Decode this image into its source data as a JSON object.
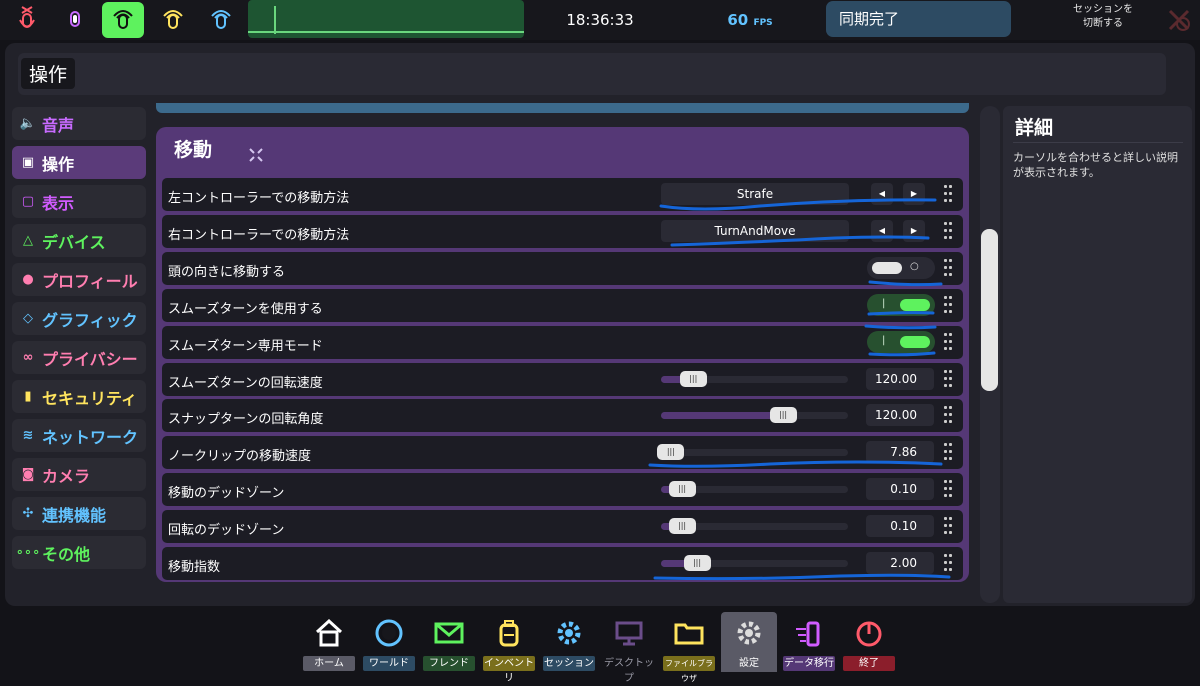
{
  "topbar": {
    "mic_buttons": [
      {
        "icon": "mic-muted-icon"
      },
      {
        "icon": "mic-off-icon"
      },
      {
        "icon": "mic-broadcast-icon",
        "active": true
      },
      {
        "icon": "mic-yellow-icon"
      },
      {
        "icon": "mic-blue-icon"
      }
    ],
    "time": "18:36:33",
    "fps_value": "60",
    "fps_unit": "FPS",
    "sync_status": "同期完了",
    "switch_session_line1": "セッションを",
    "switch_session_line2": "切断する"
  },
  "page_title": "操作",
  "nav": {
    "items": [
      {
        "label": "音声",
        "icon": "speaker-icon",
        "color": "#c86bff"
      },
      {
        "label": "操作",
        "icon": "gamepad-icon",
        "color": "#ffffff",
        "active": true
      },
      {
        "label": "表示",
        "icon": "display-icon",
        "color": "#d15cff"
      },
      {
        "label": "デバイス",
        "icon": "devices-icon",
        "color": "#5ef25e"
      },
      {
        "label": "プロフィール",
        "icon": "person-icon",
        "color": "#ff7eb0"
      },
      {
        "label": "グラフィック",
        "icon": "graphic-icon",
        "color": "#62c3ff"
      },
      {
        "label": "プライバシー",
        "icon": "privacy-icon",
        "color": "#ff7eb0"
      },
      {
        "label": "セキュリティ",
        "icon": "lock-icon",
        "color": "#ffe45e"
      },
      {
        "label": "ネットワーク",
        "icon": "wifi-icon",
        "color": "#62c3ff"
      },
      {
        "label": "カメラ",
        "icon": "camera-icon",
        "color": "#ff7eb0"
      },
      {
        "label": "連携機能",
        "icon": "integration-icon",
        "color": "#62c3ff"
      },
      {
        "label": "その他",
        "icon": "more-icon",
        "color": "#5ef25e"
      }
    ]
  },
  "section": {
    "title": "移動",
    "rows": [
      {
        "type": "select",
        "label": "左コントローラーでの移動方法",
        "value": "Strafe"
      },
      {
        "type": "select",
        "label": "右コントローラーでの移動方法",
        "value": "TurnAndMove"
      },
      {
        "type": "toggle",
        "label": "頭の向きに移動する",
        "on": false
      },
      {
        "type": "toggle",
        "label": "スムーズターンを使用する",
        "on": true
      },
      {
        "type": "toggle",
        "label": "スムーズターン専用モード",
        "on": true
      },
      {
        "type": "slider",
        "label": "スムーズターンの回転速度",
        "value": "120.00",
        "fraction": 0.17
      },
      {
        "type": "slider",
        "label": "スナップターンの回転角度",
        "value": "120.00",
        "fraction": 0.65
      },
      {
        "type": "slider",
        "label": "ノークリップの移動速度",
        "value": "7.86",
        "fraction": 0.05
      },
      {
        "type": "slider",
        "label": "移動のデッドゾーン",
        "value": "0.10",
        "fraction": 0.11
      },
      {
        "type": "slider",
        "label": "回転のデッドゾーン",
        "value": "0.10",
        "fraction": 0.11
      },
      {
        "type": "slider",
        "label": "移動指数",
        "value": "2.00",
        "fraction": 0.19
      }
    ]
  },
  "detail": {
    "title": "詳細",
    "text": "カーソルを合わせると詳しい説明が表示されます。"
  },
  "dock": {
    "items": [
      {
        "label": "ホーム",
        "icon": "home-icon",
        "label_bg": "#5a5a66"
      },
      {
        "label": "ワールド",
        "icon": "world-icon",
        "label_bg": "#2d4b63"
      },
      {
        "label": "フレンド",
        "icon": "friends-icon",
        "label_bg": "#27502f"
      },
      {
        "label": "インベントリ",
        "icon": "inventory-icon",
        "label_bg": "#7a6f1c"
      },
      {
        "label": "セッション",
        "icon": "session-icon",
        "label_bg": "#2d4b63"
      },
      {
        "label": "デスクトップ",
        "icon": "desktop-icon",
        "label_bg": "transparent",
        "dim": true
      },
      {
        "label": "ファイルブラウザ",
        "icon": "folder-icon",
        "label_bg": "#7a6f1c"
      },
      {
        "label": "設定",
        "icon": "settings-icon",
        "label_bg": "#5a5a66",
        "selected": true
      },
      {
        "label": "データ移行",
        "icon": "migration-icon",
        "label_bg": "#553876"
      },
      {
        "label": "終了",
        "icon": "power-icon",
        "label_bg": "#8b1e2b"
      }
    ]
  }
}
